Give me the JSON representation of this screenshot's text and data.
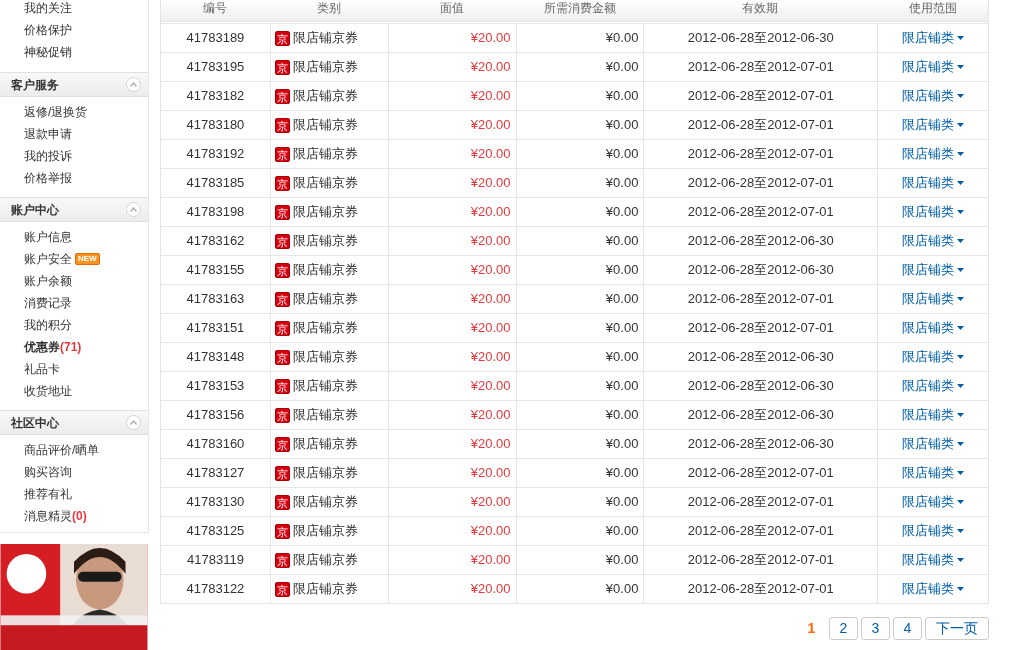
{
  "sidebar": {
    "top_items": [
      {
        "label": "我的关注",
        "selected": false
      },
      {
        "label": "价格保护",
        "selected": false
      },
      {
        "label": "神秘促销",
        "selected": false
      }
    ],
    "sections": [
      {
        "title": "客户服务",
        "expanded": true,
        "items": [
          {
            "label": "返修/退换货",
            "selected": false
          },
          {
            "label": "退款申请",
            "selected": false
          },
          {
            "label": "我的投诉",
            "selected": false
          },
          {
            "label": "价格举报",
            "selected": false
          }
        ]
      },
      {
        "title": "账户中心",
        "expanded": true,
        "items": [
          {
            "label": "账户信息",
            "selected": false
          },
          {
            "label": "账户安全",
            "selected": false,
            "badge": "NEW"
          },
          {
            "label": "账户余额",
            "selected": false
          },
          {
            "label": "消费记录",
            "selected": false
          },
          {
            "label": "我的积分",
            "selected": false
          },
          {
            "label": "优惠券",
            "selected": true,
            "count": "(71)"
          },
          {
            "label": "礼品卡",
            "selected": false
          },
          {
            "label": "收货地址",
            "selected": false
          }
        ]
      },
      {
        "title": "社区中心",
        "expanded": true,
        "items": [
          {
            "label": "商品评价/晒单",
            "selected": false
          },
          {
            "label": "购买咨询",
            "selected": false
          },
          {
            "label": "推荐有礼",
            "selected": false
          },
          {
            "label": "消息精灵",
            "selected": false,
            "count": "(0)"
          }
        ]
      }
    ]
  },
  "table": {
    "columns": [
      "编号",
      "类别",
      "面值",
      "所需消费金额",
      "有效期",
      "使用范围"
    ],
    "rows": [
      {
        "id": "41783189",
        "badge": "京",
        "type": "限店铺京券",
        "value": "¥20.00",
        "min_spend": "¥0.00",
        "validity": "2012-06-28至2012-06-30",
        "scope": "限店铺类"
      },
      {
        "id": "41783195",
        "badge": "京",
        "type": "限店铺京券",
        "value": "¥20.00",
        "min_spend": "¥0.00",
        "validity": "2012-06-28至2012-07-01",
        "scope": "限店铺类"
      },
      {
        "id": "41783182",
        "badge": "京",
        "type": "限店铺京券",
        "value": "¥20.00",
        "min_spend": "¥0.00",
        "validity": "2012-06-28至2012-07-01",
        "scope": "限店铺类"
      },
      {
        "id": "41783180",
        "badge": "京",
        "type": "限店铺京券",
        "value": "¥20.00",
        "min_spend": "¥0.00",
        "validity": "2012-06-28至2012-07-01",
        "scope": "限店铺类"
      },
      {
        "id": "41783192",
        "badge": "京",
        "type": "限店铺京券",
        "value": "¥20.00",
        "min_spend": "¥0.00",
        "validity": "2012-06-28至2012-07-01",
        "scope": "限店铺类"
      },
      {
        "id": "41783185",
        "badge": "京",
        "type": "限店铺京券",
        "value": "¥20.00",
        "min_spend": "¥0.00",
        "validity": "2012-06-28至2012-07-01",
        "scope": "限店铺类"
      },
      {
        "id": "41783198",
        "badge": "京",
        "type": "限店铺京券",
        "value": "¥20.00",
        "min_spend": "¥0.00",
        "validity": "2012-06-28至2012-07-01",
        "scope": "限店铺类"
      },
      {
        "id": "41783162",
        "badge": "京",
        "type": "限店铺京券",
        "value": "¥20.00",
        "min_spend": "¥0.00",
        "validity": "2012-06-28至2012-06-30",
        "scope": "限店铺类"
      },
      {
        "id": "41783155",
        "badge": "京",
        "type": "限店铺京券",
        "value": "¥20.00",
        "min_spend": "¥0.00",
        "validity": "2012-06-28至2012-06-30",
        "scope": "限店铺类"
      },
      {
        "id": "41783163",
        "badge": "京",
        "type": "限店铺京券",
        "value": "¥20.00",
        "min_spend": "¥0.00",
        "validity": "2012-06-28至2012-07-01",
        "scope": "限店铺类"
      },
      {
        "id": "41783151",
        "badge": "京",
        "type": "限店铺京券",
        "value": "¥20.00",
        "min_spend": "¥0.00",
        "validity": "2012-06-28至2012-07-01",
        "scope": "限店铺类"
      },
      {
        "id": "41783148",
        "badge": "京",
        "type": "限店铺京券",
        "value": "¥20.00",
        "min_spend": "¥0.00",
        "validity": "2012-06-28至2012-06-30",
        "scope": "限店铺类"
      },
      {
        "id": "41783153",
        "badge": "京",
        "type": "限店铺京券",
        "value": "¥20.00",
        "min_spend": "¥0.00",
        "validity": "2012-06-28至2012-06-30",
        "scope": "限店铺类"
      },
      {
        "id": "41783156",
        "badge": "京",
        "type": "限店铺京券",
        "value": "¥20.00",
        "min_spend": "¥0.00",
        "validity": "2012-06-28至2012-06-30",
        "scope": "限店铺类"
      },
      {
        "id": "41783160",
        "badge": "京",
        "type": "限店铺京券",
        "value": "¥20.00",
        "min_spend": "¥0.00",
        "validity": "2012-06-28至2012-06-30",
        "scope": "限店铺类"
      },
      {
        "id": "41783127",
        "badge": "京",
        "type": "限店铺京券",
        "value": "¥20.00",
        "min_spend": "¥0.00",
        "validity": "2012-06-28至2012-07-01",
        "scope": "限店铺类"
      },
      {
        "id": "41783130",
        "badge": "京",
        "type": "限店铺京券",
        "value": "¥20.00",
        "min_spend": "¥0.00",
        "validity": "2012-06-28至2012-07-01",
        "scope": "限店铺类"
      },
      {
        "id": "41783125",
        "badge": "京",
        "type": "限店铺京券",
        "value": "¥20.00",
        "min_spend": "¥0.00",
        "validity": "2012-06-28至2012-07-01",
        "scope": "限店铺类"
      },
      {
        "id": "41783119",
        "badge": "京",
        "type": "限店铺京券",
        "value": "¥20.00",
        "min_spend": "¥0.00",
        "validity": "2012-06-28至2012-07-01",
        "scope": "限店铺类"
      },
      {
        "id": "41783122",
        "badge": "京",
        "type": "限店铺京券",
        "value": "¥20.00",
        "min_spend": "¥0.00",
        "validity": "2012-06-28至2012-07-01",
        "scope": "限店铺类"
      }
    ]
  },
  "pagination": {
    "pages": [
      {
        "label": "1",
        "selected": true
      },
      {
        "label": "2",
        "selected": false
      },
      {
        "label": "3",
        "selected": false
      },
      {
        "label": "4",
        "selected": false
      }
    ],
    "next": "下一页"
  }
}
